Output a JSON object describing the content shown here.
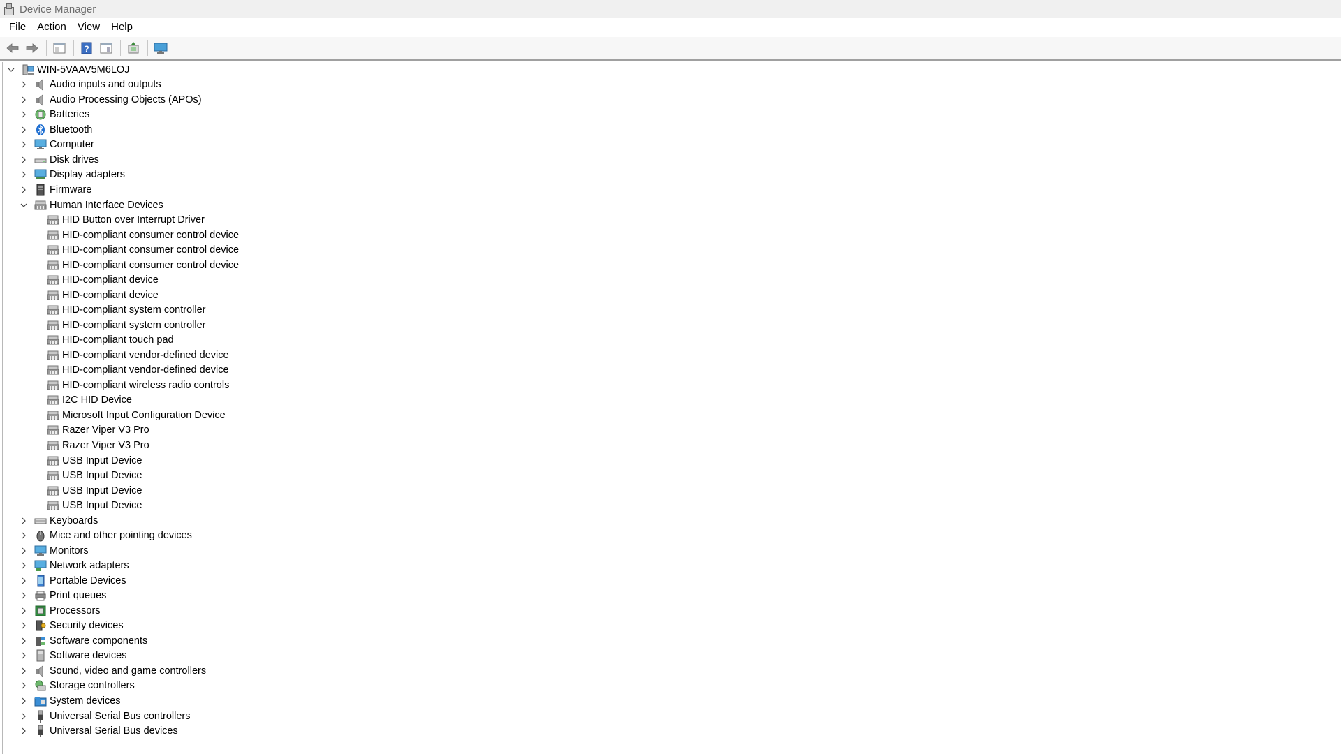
{
  "window": {
    "title": "Device Manager"
  },
  "menu": [
    "File",
    "Action",
    "View",
    "Help"
  ],
  "toolbar": {
    "buttons": [
      "back-arrow-icon",
      "forward-arrow-icon",
      "properties-sheet-icon",
      "help-icon",
      "show-hide-console-icon",
      "scan-hardware-icon",
      "monitor-icon"
    ]
  },
  "tree": {
    "root": {
      "label": "WIN-5VAAV5M6LOJ",
      "icon": "computer-icon"
    },
    "categories": [
      {
        "label": "Audio inputs and outputs",
        "icon": "speaker-icon",
        "expanded": false
      },
      {
        "label": "Audio Processing Objects (APOs)",
        "icon": "speaker-icon",
        "expanded": false
      },
      {
        "label": "Batteries",
        "icon": "battery-icon",
        "expanded": false
      },
      {
        "label": "Bluetooth",
        "icon": "bluetooth-icon",
        "expanded": false
      },
      {
        "label": "Computer",
        "icon": "monitor-icon",
        "expanded": false
      },
      {
        "label": "Disk drives",
        "icon": "disk-drive-icon",
        "expanded": false
      },
      {
        "label": "Display adapters",
        "icon": "display-adapter-icon",
        "expanded": false
      },
      {
        "label": "Firmware",
        "icon": "firmware-icon",
        "expanded": false
      },
      {
        "label": "Human Interface Devices",
        "icon": "hid-icon",
        "expanded": true,
        "children": [
          "HID Button over Interrupt Driver",
          "HID-compliant consumer control device",
          "HID-compliant consumer control device",
          "HID-compliant consumer control device",
          "HID-compliant device",
          "HID-compliant device",
          "HID-compliant system controller",
          "HID-compliant system controller",
          "HID-compliant touch pad",
          "HID-compliant vendor-defined device",
          "HID-compliant vendor-defined device",
          "HID-compliant wireless radio controls",
          "I2C HID Device",
          "Microsoft Input Configuration Device",
          "Razer Viper V3 Pro",
          "Razer Viper V3 Pro",
          "USB Input Device",
          "USB Input Device",
          "USB Input Device",
          "USB Input Device"
        ]
      },
      {
        "label": "Keyboards",
        "icon": "keyboard-icon",
        "expanded": false
      },
      {
        "label": "Mice and other pointing devices",
        "icon": "mouse-icon",
        "expanded": false
      },
      {
        "label": "Monitors",
        "icon": "monitor-icon",
        "expanded": false
      },
      {
        "label": "Network adapters",
        "icon": "network-adapter-icon",
        "expanded": false
      },
      {
        "label": "Portable Devices",
        "icon": "portable-device-icon",
        "expanded": false
      },
      {
        "label": "Print queues",
        "icon": "printer-icon",
        "expanded": false
      },
      {
        "label": "Processors",
        "icon": "processor-icon",
        "expanded": false
      },
      {
        "label": "Security devices",
        "icon": "security-device-icon",
        "expanded": false
      },
      {
        "label": "Software components",
        "icon": "software-component-icon",
        "expanded": false
      },
      {
        "label": "Software devices",
        "icon": "software-device-icon",
        "expanded": false
      },
      {
        "label": "Sound, video and game controllers",
        "icon": "speaker-icon",
        "expanded": false
      },
      {
        "label": "Storage controllers",
        "icon": "storage-controller-icon",
        "expanded": false
      },
      {
        "label": "System devices",
        "icon": "system-folder-icon",
        "expanded": false
      },
      {
        "label": "Universal Serial Bus controllers",
        "icon": "usb-icon",
        "expanded": false
      },
      {
        "label": "Universal Serial Bus devices",
        "icon": "usb-icon",
        "expanded": false
      }
    ]
  }
}
